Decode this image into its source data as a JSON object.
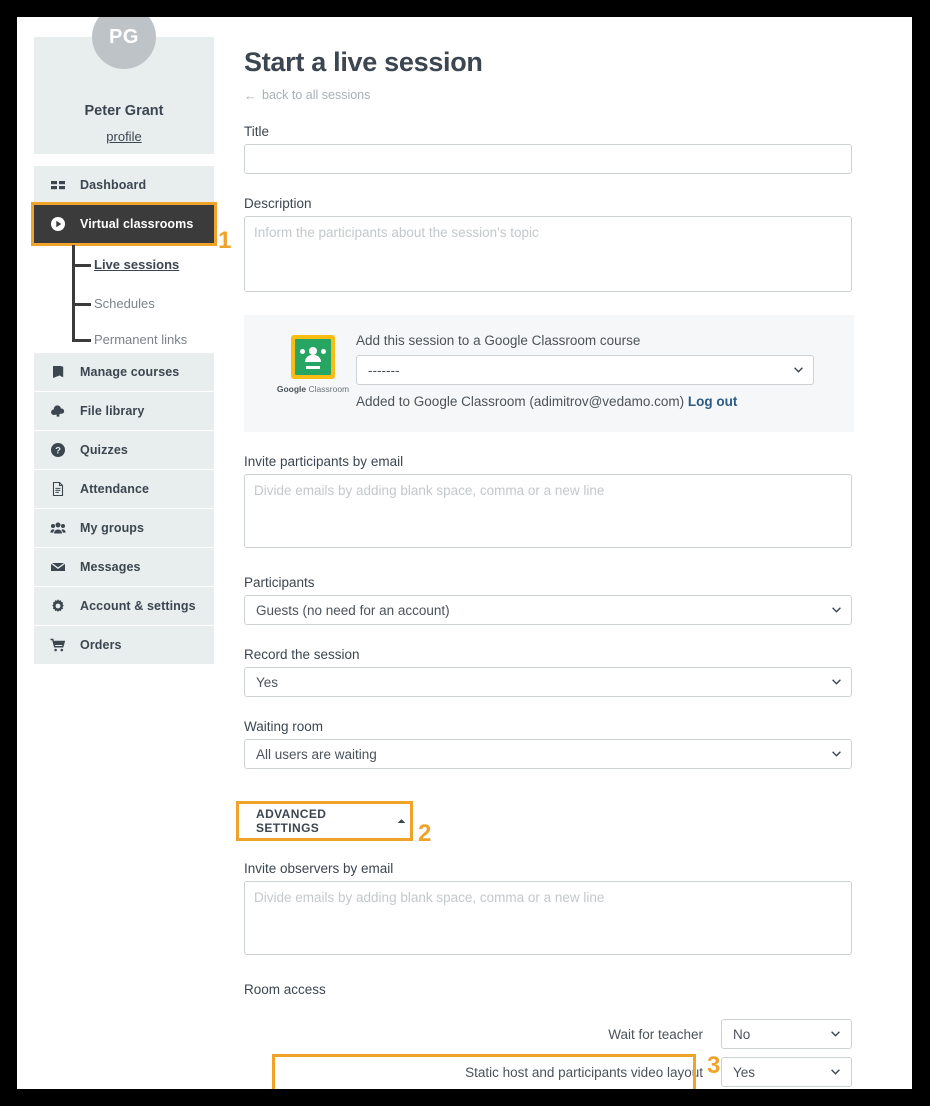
{
  "profile": {
    "initials": "PG",
    "name": "Peter Grant",
    "link": "profile"
  },
  "sidebar": {
    "items": [
      {
        "label": "Dashboard",
        "icon": "grid-icon"
      },
      {
        "label": "Virtual classrooms",
        "icon": "play-circle-icon"
      },
      {
        "label": "Manage courses",
        "icon": "book-icon"
      },
      {
        "label": "File library",
        "icon": "cloud-upload-icon"
      },
      {
        "label": "Quizzes",
        "icon": "question-circle-icon"
      },
      {
        "label": "Attendance",
        "icon": "document-icon"
      },
      {
        "label": "My groups",
        "icon": "users-icon"
      },
      {
        "label": "Messages",
        "icon": "envelope-icon"
      },
      {
        "label": "Account & settings",
        "icon": "gear-icon"
      },
      {
        "label": "Orders",
        "icon": "cart-icon"
      }
    ],
    "subitems": [
      {
        "label": "Live sessions"
      },
      {
        "label": "Schedules"
      },
      {
        "label": "Permanent links"
      }
    ]
  },
  "main": {
    "title": "Start a live session",
    "back_link": "back to all sessions",
    "back_arrow": "←",
    "title_field": {
      "label": "Title",
      "value": "",
      "placeholder": ""
    },
    "description_field": {
      "label": "Description",
      "value": "",
      "placeholder": "Inform the participants about the session's topic"
    },
    "google_classroom": {
      "logo_caption_brand": "Google",
      "logo_caption_rest": " Classroom",
      "heading": "Add this session to a Google Classroom course",
      "select_value": "-------",
      "status_text": "Added to Google Classroom (adimitrov@vedamo.com)",
      "logout_label": "Log out"
    },
    "invite_participants": {
      "label": "Invite participants by email",
      "value": "",
      "placeholder": "Divide emails by adding blank space, comma or a new line"
    },
    "participants": {
      "label": "Participants",
      "value": "Guests (no need for an account)"
    },
    "record_session": {
      "label": "Record the session",
      "value": "Yes"
    },
    "waiting_room": {
      "label": "Waiting room",
      "value": "All users are waiting"
    },
    "advanced_settings": {
      "label": "ADVANCED SETTINGS"
    },
    "invite_observers": {
      "label": "Invite observers by email",
      "value": "",
      "placeholder": "Divide emails by adding blank space, comma or a new line"
    },
    "room_access": {
      "label": "Room access",
      "rows": [
        {
          "label": "Wait for teacher",
          "value": "No"
        },
        {
          "label": "Static host and participants video layout",
          "value": "Yes"
        }
      ]
    }
  },
  "callouts": [
    {
      "number": "1"
    },
    {
      "number": "2"
    },
    {
      "number": "3"
    }
  ],
  "colors": {
    "accent_orange": "#f0a32a",
    "sidebar_bg": "#e8edee",
    "active_bg": "#3b3b3b",
    "text_dark": "#3c4650",
    "link_blue": "#2a5b85"
  }
}
